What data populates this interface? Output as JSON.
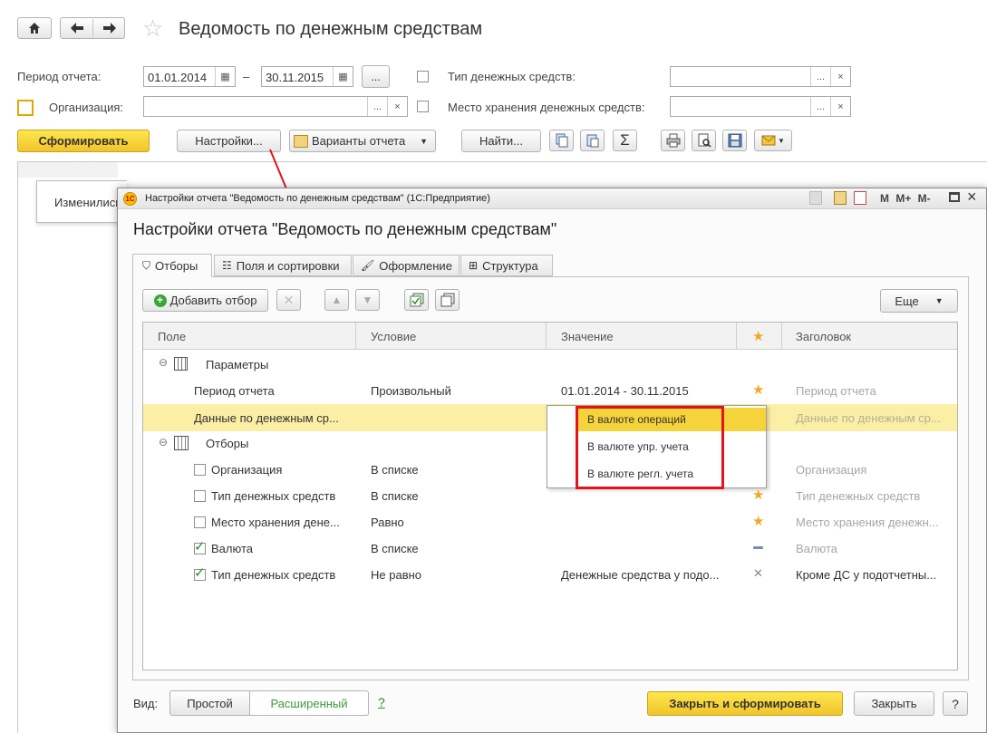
{
  "main": {
    "title": "Ведомость по денежным средствам",
    "period_label": "Период отчета:",
    "date_from": "01.01.2014",
    "date_dash": "–",
    "date_to": "30.11.2015",
    "dots": "...",
    "org_label": "Организация:",
    "money_type_label": "Тип денежных средств:",
    "storage_label": "Место хранения денежных средств:",
    "btn_generate": "Сформировать",
    "btn_settings": "Настройки...",
    "btn_variants": "Варианты отчета",
    "btn_find": "Найти...",
    "changed_text": "Изменились"
  },
  "dialog": {
    "window_title": "Настройки отчета \"Ведомость по денежным средствам\"  (1С:Предприятие)",
    "heading": "Настройки отчета \"Ведомость по денежным средствам\"",
    "tabs": [
      "Отборы",
      "Поля и сортировки",
      "Оформление",
      "Структура"
    ],
    "btn_add_filter": "Добавить отбор",
    "btn_more": "Еще",
    "columns": [
      "Поле",
      "Условие",
      "Значение",
      "Заголовок"
    ],
    "group_params": "Параметры",
    "group_filters": "Отборы",
    "rows": [
      {
        "field": "Период отчета",
        "cond": "Произвольный",
        "value": "01.01.2014 - 30.11.2015",
        "title": "Период отчета"
      },
      {
        "field": "Данные по денежным ср...",
        "cond": "",
        "value": "",
        "title": "Данные по денежным ср..."
      },
      {
        "field": "Организация",
        "cond": "В списке",
        "value": "",
        "title": "Организация"
      },
      {
        "field": "Тип денежных средств",
        "cond": "В списке",
        "value": "",
        "title": "Тип денежных средств"
      },
      {
        "field": "Место хранения дене...",
        "cond": "Равно",
        "value": "",
        "title": "Место хранения денежн..."
      },
      {
        "field": "Валюта",
        "cond": "В списке",
        "value": "",
        "title": "Валюта"
      },
      {
        "field": "Тип денежных средств",
        "cond": "Не равно",
        "value": "Денежные средства у подо...",
        "title": "Кроме ДС у подотчетны..."
      }
    ],
    "dropdown": [
      "В валюте операций",
      "В валюте упр. учета",
      "В валюте регл. учета"
    ],
    "view_label": "Вид:",
    "view_simple": "Простой",
    "view_extended": "Расширенный",
    "help": "?",
    "btn_close_generate": "Закрыть и сформировать",
    "btn_close": "Закрыть",
    "help_btn": "?",
    "win_controls": "M M+ M-"
  },
  "colors": {
    "accent_yellow": "#f5d33a",
    "highlight_row": "#fbeea5",
    "red_box": "#e0141c",
    "star": "#f5a623",
    "green_text": "#3a9a3a"
  }
}
